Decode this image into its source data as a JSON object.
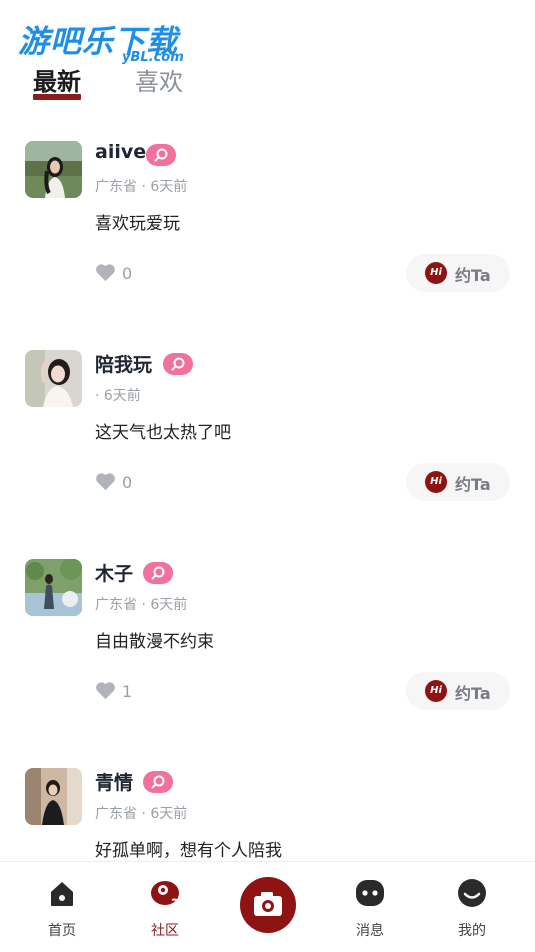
{
  "watermark": {
    "main": "游吧乐下载",
    "sub": "yBL.com"
  },
  "tabs": {
    "latest": "最新",
    "like": "喜欢"
  },
  "posts": [
    {
      "name": "aiive",
      "meta": "广东省 · 6天前",
      "content": "喜欢玩爱玩",
      "likes": "0",
      "action": "约Ta",
      "hi": "Hi"
    },
    {
      "name": "陪我玩",
      "meta": "· 6天前",
      "content": "这天气也太热了吧",
      "likes": "0",
      "action": "约Ta",
      "hi": "Hi"
    },
    {
      "name": "木子",
      "meta": "广东省 · 6天前",
      "content": "自由散漫不约束",
      "likes": "1",
      "action": "约Ta",
      "hi": "Hi"
    },
    {
      "name": "青情",
      "meta": "广东省 · 6天前",
      "content": "好孤单啊，想有个人陪我",
      "likes": "",
      "action": "",
      "hi": ""
    }
  ],
  "nav": {
    "home": "首页",
    "community": "社区",
    "messages": "消息",
    "mine": "我的"
  },
  "colors": {
    "accent": "#8e1414",
    "badge": "#f1709e"
  }
}
